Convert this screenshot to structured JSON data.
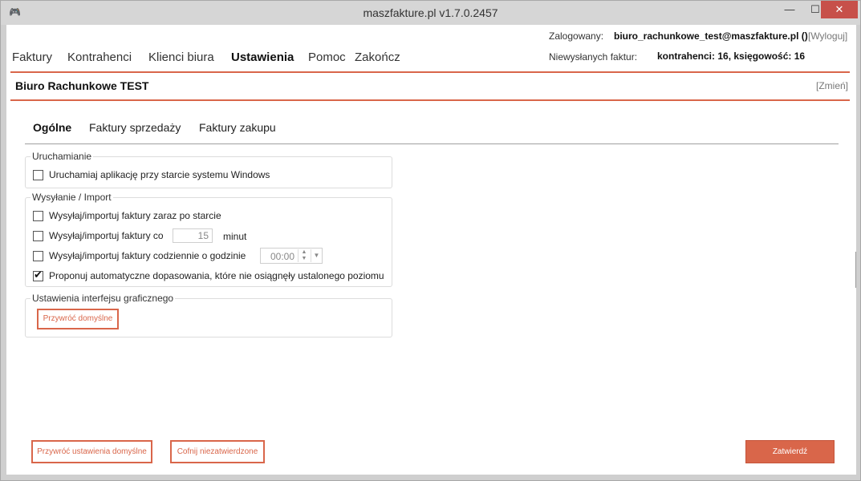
{
  "window": {
    "title": "maszfakture.pl  v1.7.0.2457",
    "minimize": "—",
    "maximize": "☐",
    "close": "✕"
  },
  "nav": {
    "items": [
      {
        "label": "Faktury"
      },
      {
        "label": "Kontrahenci"
      },
      {
        "label": "Klienci biura"
      },
      {
        "label": "Ustawienia",
        "active": true
      },
      {
        "label": "Pomoc"
      },
      {
        "label": "Zakończ"
      }
    ]
  },
  "account": {
    "logged_label": "Zalogowany:",
    "user": "biuro_rachunkowe_test@maszfakture.pl ()",
    "logout": "[Wyloguj]",
    "unsent_label": "Niewysłanych faktur:",
    "unsent_value": "kontrahenci: 16, księgowość: 16"
  },
  "company": {
    "name": "Biuro Rachunkowe TEST",
    "change": "[Zmień]"
  },
  "tabs": [
    {
      "label": "Ogólne",
      "active": true
    },
    {
      "label": "Faktury sprzedaży"
    },
    {
      "label": "Faktury zakupu"
    }
  ],
  "groups": {
    "startup": {
      "title": "Uruchamianie",
      "run_at_startup": {
        "label": "Uruchamiaj aplikację przy starcie systemu Windows",
        "checked": false
      }
    },
    "send_import": {
      "title": "Wysyłanie / Import",
      "on_start": {
        "label": "Wysyłaj/importuj faktury zaraz po starcie",
        "checked": false
      },
      "every": {
        "label": "Wysyłaj/importuj faktury co",
        "checked": false,
        "value": "15",
        "unit": "minut"
      },
      "daily": {
        "label": "Wysyłaj/importuj faktury codziennie o godzinie",
        "checked": false,
        "time": "00:00"
      },
      "propose": {
        "label": "Proponuj automatyczne dopasowania, które nie osiągnęły ustalonego poziomu",
        "checked": true
      }
    },
    "ui": {
      "title": "Ustawienia interfejsu graficznego",
      "reset_button": "Przywróć domyślne"
    }
  },
  "footer": {
    "restore_defaults": "Przywróć ustawienia domyślne",
    "undo_unsaved": "Cofnij niezatwierdzone",
    "confirm": "Zatwierdź"
  },
  "colors": {
    "accent": "#d9664a",
    "close_button": "#c7504a"
  }
}
